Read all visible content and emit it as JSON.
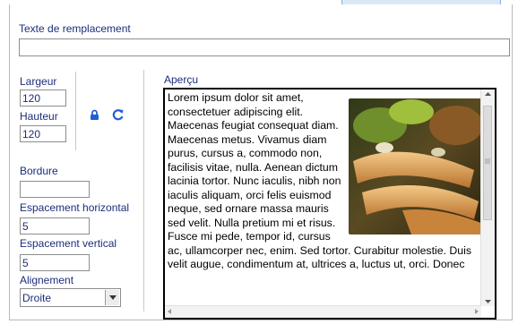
{
  "alt_text": {
    "label": "Texte de remplacement",
    "value": ""
  },
  "dimensions": {
    "width_label": "Largeur",
    "width_value": "120",
    "height_label": "Hauteur",
    "height_value": "120",
    "lock_icon": "lock-icon",
    "reset_icon": "refresh-icon"
  },
  "border": {
    "label": "Bordure",
    "value": ""
  },
  "hspace": {
    "label": "Espacement horizontal",
    "value": "5"
  },
  "vspace": {
    "label": "Espacement vertical",
    "value": "5"
  },
  "alignment": {
    "label": "Alignement",
    "value": "Droite"
  },
  "preview": {
    "label": "Aperçu",
    "text": "Lorem ipsum dolor sit amet, consectetuer adipiscing elit. Maecenas feugiat consequat diam. Maecenas metus. Vivamus diam purus, cursus a, commodo non, facilisis vitae, nulla. Aenean dictum lacinia tortor. Nunc iaculis, nibh non iaculis aliquam, orci felis euismod neque, sed ornare massa mauris sed velit. Nulla pretium mi et risus. Fusce mi pede, tempor id, cursus ac, ullamcorper nec, enim. Sed tortor. Curabitur molestie. Duis velit augue, condimentum at, ultrices a, luctus ut, orci. Donec"
  },
  "colors": {
    "label": "#1d2d7a",
    "icon_blue": "#1f5fd6"
  }
}
